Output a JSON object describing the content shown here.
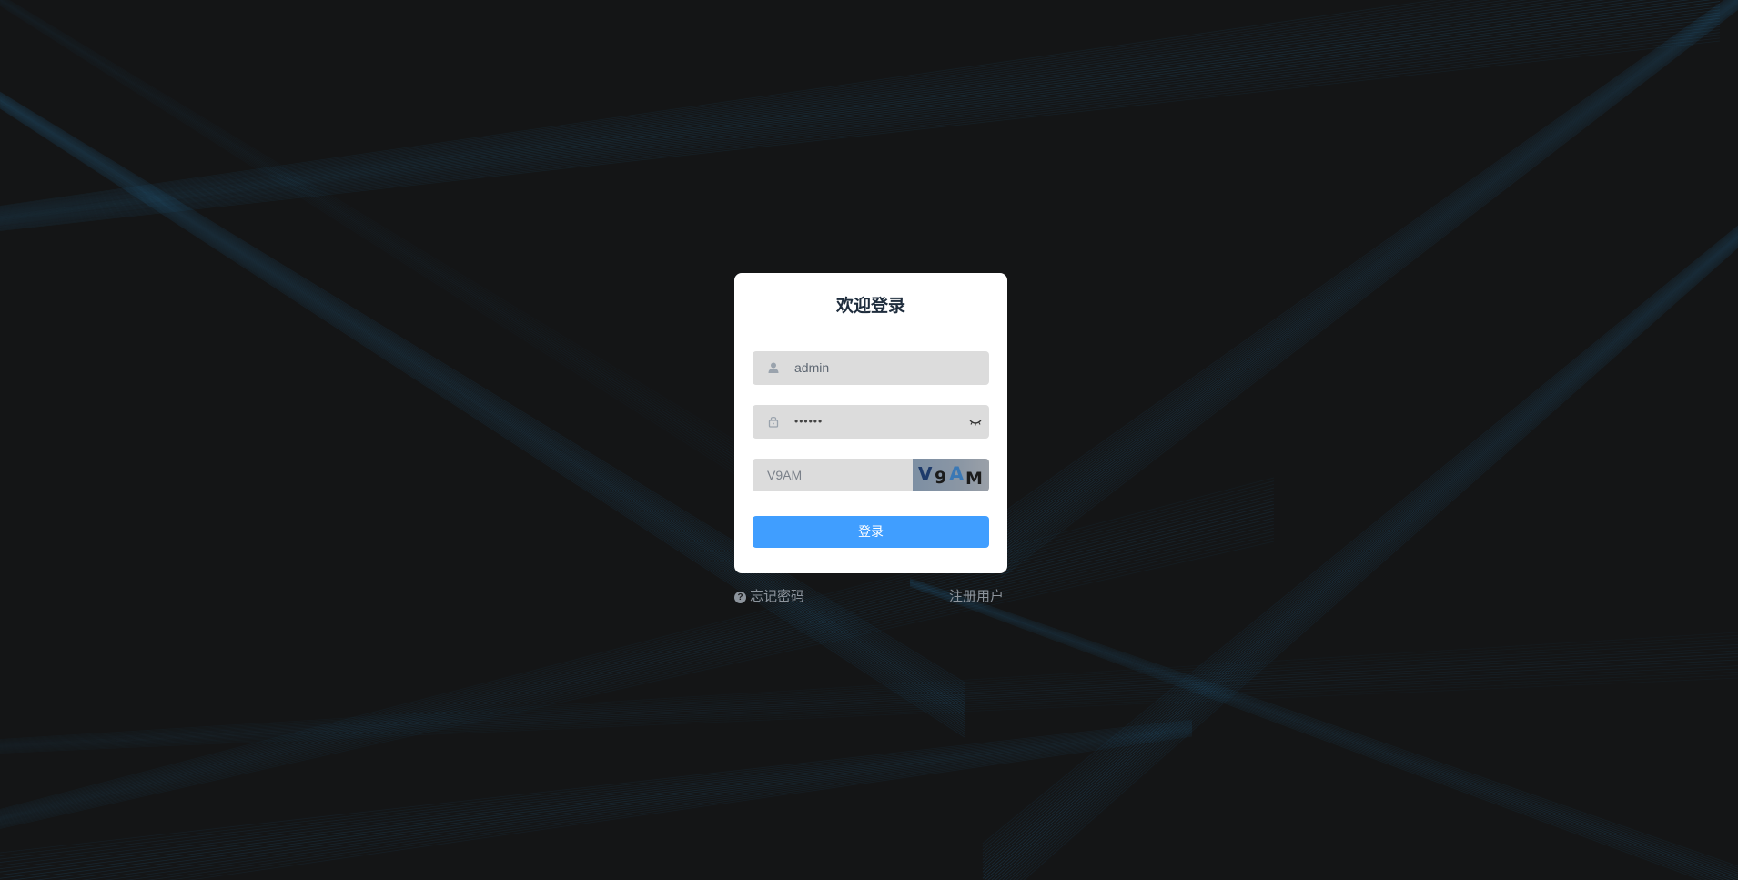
{
  "login": {
    "title": "欢迎登录",
    "username_value": "admin",
    "password_value": "••••••",
    "captcha_value": "V9AM",
    "captcha_image": {
      "chars": [
        "V",
        "9",
        "A",
        "M"
      ],
      "colors": [
        "#1d3a6b",
        "#1b1b1b",
        "#3a78b5",
        "#1b1b1b"
      ]
    },
    "login_button": "登录",
    "forgot_password": "忘记密码",
    "register_user": "注册用户"
  },
  "icons": {
    "username": "user-icon",
    "password": "lock-icon",
    "toggle_password": "eye-closed-icon",
    "forgot": "question-circle-icon"
  },
  "colors": {
    "background": "#141516",
    "accent_lines": "#2e8bc7",
    "primary_button": "#409eff",
    "input_background": "#dcdcdc"
  }
}
